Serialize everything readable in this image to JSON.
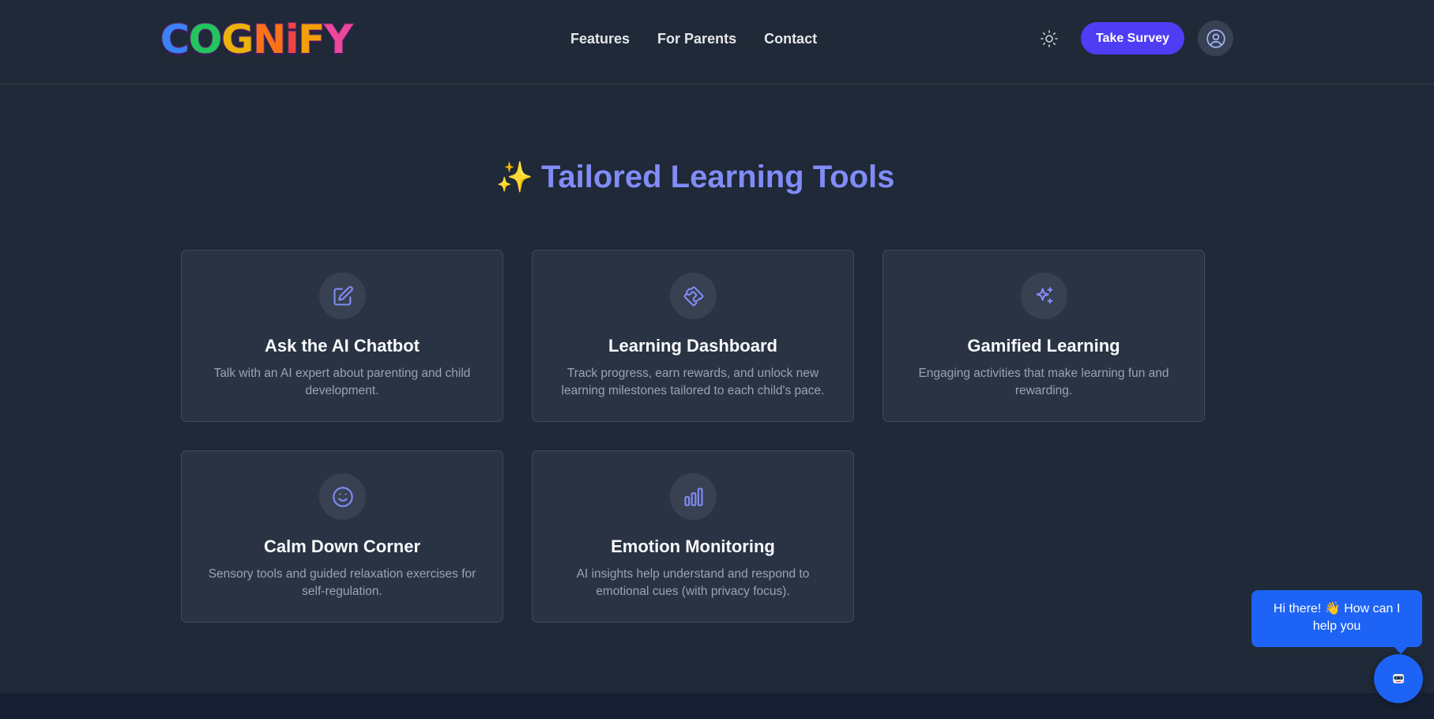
{
  "header": {
    "logo_letters": [
      {
        "char": "C",
        "color": "#3b82f6"
      },
      {
        "char": "O",
        "color": "#22c55e"
      },
      {
        "char": "G",
        "color": "#eab308"
      },
      {
        "char": "N",
        "color": "#f97316"
      },
      {
        "char": "i",
        "color": "#ef4444"
      },
      {
        "char": "F",
        "color": "#f59e0b"
      },
      {
        "char": "Y",
        "color": "#ec4899"
      }
    ],
    "nav": [
      "Features",
      "For Parents",
      "Contact"
    ],
    "survey_label": "Take Survey"
  },
  "section": {
    "spark": "✨",
    "title": "Tailored Learning Tools"
  },
  "cards": [
    {
      "icon": "edit-icon",
      "title": "Ask the AI Chatbot",
      "desc": "Talk with an AI expert about parenting and child development."
    },
    {
      "icon": "puzzle-icon",
      "title": "Learning Dashboard",
      "desc": "Track progress, earn rewards, and unlock new learning milestones tailored to each child's pace."
    },
    {
      "icon": "sparkles-icon",
      "title": "Gamified Learning",
      "desc": "Engaging activities that make learning fun and rewarding."
    },
    {
      "icon": "smile-icon",
      "title": "Calm Down Corner",
      "desc": "Sensory tools and guided relaxation exercises for self-regulation."
    },
    {
      "icon": "bar-chart-icon",
      "title": "Emotion Monitoring",
      "desc": "AI insights help understand and respond to emotional cues (with privacy focus)."
    }
  ],
  "chat": {
    "greeting": "Hi there! 👋 How can I help you"
  },
  "colors": {
    "accent": "#818cf8",
    "button": "#4f3df5",
    "chat": "#1d63f5",
    "background": "#1f2937"
  }
}
